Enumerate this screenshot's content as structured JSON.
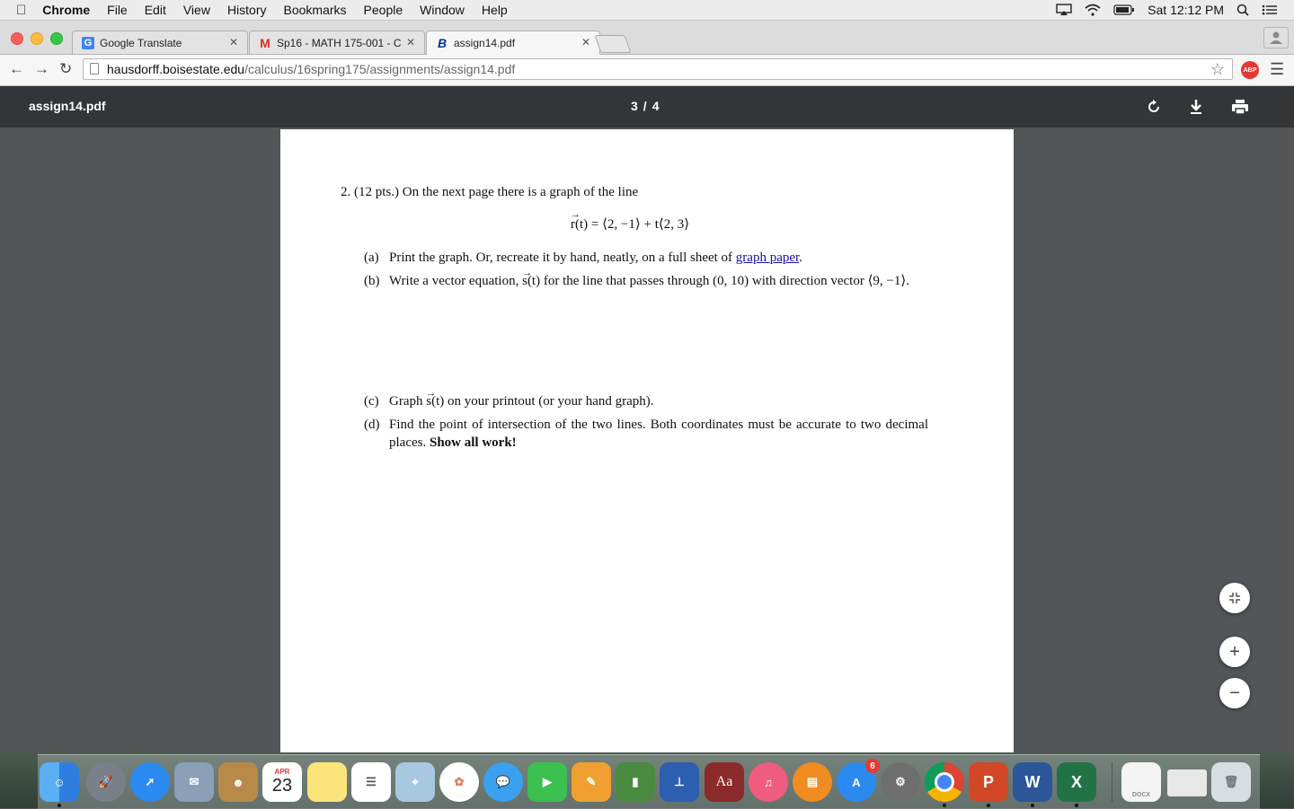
{
  "menubar": {
    "app_name": "Chrome",
    "items": [
      "File",
      "Edit",
      "View",
      "History",
      "Bookmarks",
      "People",
      "Window",
      "Help"
    ],
    "clock": "Sat 12:12 PM"
  },
  "tabs": [
    {
      "title": "Google Translate",
      "favicon": "G"
    },
    {
      "title": "Sp16 - MATH 175-001 - C",
      "favicon": "M"
    },
    {
      "title": "assign14.pdf",
      "favicon": "B"
    }
  ],
  "toolbar": {
    "url_host": "hausdorff.boisestate.edu",
    "url_path": "/calculus/16spring175/assignments/assign14.pdf",
    "abp_label": "ABP"
  },
  "pdf_viewer": {
    "title": "assign14.pdf",
    "current_page": "3",
    "separator": "/",
    "total_pages": "4"
  },
  "document": {
    "question": "2. (12 pts.) On the next page there is a graph of the line",
    "equation_vec": "r",
    "equation_rest": "(t) = ⟨2, −1⟩ + t⟨2, 3⟩",
    "parts": [
      {
        "label": "(a)",
        "text_before": "Print the graph. Or, recreate it by hand, neatly, on a full sheet of ",
        "link": "graph paper",
        "text_after": "."
      },
      {
        "label": "(b)",
        "text_before": "Write a vector equation, ",
        "vec": "s",
        "text_after": "(t) for the line that passes through (0, 10) with direction vector ⟨9, −1⟩."
      },
      {
        "label": "(c)",
        "text_before": "Graph ",
        "vec": "s",
        "text_after": "(t) on your printout (or your hand graph)."
      },
      {
        "label": "(d)",
        "text_before": "Find the point of intersection of the two lines. Both coordinates must be accurate to two decimal places. ",
        "bold": "Show all work!"
      }
    ]
  },
  "zoom": {
    "plus": "+",
    "minus": "−"
  },
  "dock": {
    "calendar_month": "APR",
    "calendar_day": "23",
    "dictionary_label": "Aa",
    "appstore_badge": "6",
    "ppt_label": "P",
    "word_label": "W",
    "excel_label": "X",
    "file_label": "DOCX"
  }
}
